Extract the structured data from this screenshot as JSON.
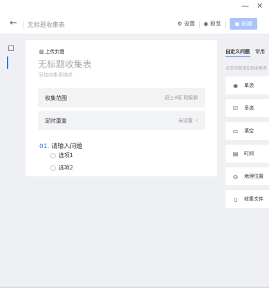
{
  "window": {
    "minimize_glyph": "—",
    "close_glyph": "✕"
  },
  "header": {
    "back_icon": "arrow-left-icon",
    "title": "无标题收集表",
    "settings_label": "设置",
    "preview_label": "预览",
    "create_label": "创建"
  },
  "form": {
    "upload_cover_label": "上传封面",
    "title": "无标题收集表",
    "description_placeholder": "添加收集表描述",
    "scope": {
      "label": "收集范围",
      "value": "初三3班 班级群"
    },
    "repeat": {
      "label": "定时重复",
      "value": "未设置"
    },
    "question": {
      "number": "01.",
      "title": "请输入问题",
      "options": [
        "选项1",
        "选项2"
      ]
    }
  },
  "right_panel": {
    "tabs": [
      "自定义问题",
      "常用"
    ],
    "hint": "点击问题添加到收集表",
    "items": [
      {
        "label": "单选",
        "icon": "radio-icon"
      },
      {
        "label": "多选",
        "icon": "checkbox-icon"
      },
      {
        "label": "填空",
        "icon": "text-input-icon"
      },
      {
        "label": "时间",
        "icon": "calendar-icon"
      },
      {
        "label": "地理位置",
        "icon": "location-icon"
      },
      {
        "label": "收集文件",
        "icon": "file-icon"
      }
    ]
  },
  "colors": {
    "accent": "#3370ff",
    "create_button": "#a9c4fb"
  }
}
